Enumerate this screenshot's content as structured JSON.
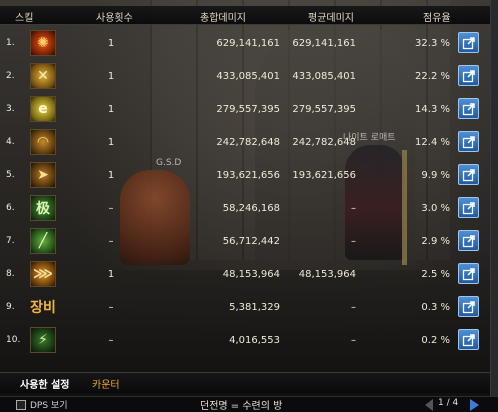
{
  "header": {
    "skill": "스킬",
    "uses": "사용횟수",
    "total_damage": "총합데미지",
    "avg_damage": "평균데미지",
    "share": "점유율"
  },
  "npc_labels": [
    "G.S.D",
    "나이트 로매트"
  ],
  "rows": [
    {
      "num": "1.",
      "icon": "fire-claw-skill-icon",
      "icon_glyph": "✺",
      "icon_style": "ic-fire",
      "uses": "1",
      "total": "629,141,161",
      "avg": "629,141,161",
      "share": "32.3 %"
    },
    {
      "num": "2.",
      "icon": "crossed-blades-skill-icon",
      "icon_glyph": "✕",
      "icon_style": "ic-gold",
      "uses": "1",
      "total": "433,085,401",
      "avg": "433,085,401",
      "share": "22.2 %"
    },
    {
      "num": "3.",
      "icon": "swirl-skill-icon",
      "icon_glyph": "e",
      "icon_style": "ic-yel",
      "uses": "1",
      "total": "279,557,395",
      "avg": "279,557,395",
      "share": "14.3 %"
    },
    {
      "num": "4.",
      "icon": "arc-slash-skill-icon",
      "icon_glyph": "◠",
      "icon_style": "ic-arc",
      "uses": "1",
      "total": "242,782,648",
      "avg": "242,782,648",
      "share": "12.4 %"
    },
    {
      "num": "5.",
      "icon": "dash-skill-icon",
      "icon_glyph": "➤",
      "icon_style": "ic-dash",
      "uses": "1",
      "total": "193,621,656",
      "avg": "193,621,656",
      "share": "9.9 %"
    },
    {
      "num": "6.",
      "icon": "glyph-skill-icon",
      "icon_glyph": "极",
      "icon_style": "ic-grn",
      "uses": "–",
      "total": "58,246,168",
      "avg": "–",
      "share": "3.0 %"
    },
    {
      "num": "7.",
      "icon": "green-slash-skill-icon",
      "icon_glyph": "╱",
      "icon_style": "ic-grn2",
      "uses": "–",
      "total": "56,712,442",
      "avg": "–",
      "share": "2.9 %"
    },
    {
      "num": "8.",
      "icon": "claw-skill-icon",
      "icon_glyph": "⋙",
      "icon_style": "ic-claw",
      "uses": "1",
      "total": "48,153,964",
      "avg": "48,153,964",
      "share": "2.5 %"
    },
    {
      "num": "9.",
      "icon": "equipment-text-icon",
      "icon_glyph": "장비",
      "icon_style": "ic-txt",
      "uses": "–",
      "total": "5,381,329",
      "avg": "–",
      "share": "0.3 %"
    },
    {
      "num": "10.",
      "icon": "green-bolt-skill-icon",
      "icon_glyph": "⚡",
      "icon_style": "ic-bolt",
      "uses": "–",
      "total": "4,016,553",
      "avg": "–",
      "share": "0.2 %"
    }
  ],
  "tabs": {
    "used_skills": "사용한 설정",
    "counter": "카운터"
  },
  "status": {
    "dps_label": "DPS 보기",
    "dungeon": "던전명 = 수련의 방",
    "page": "1 / 4"
  },
  "colors": {
    "accent_blue": "#1d5aa3",
    "counter_tab": "#f0a630"
  }
}
